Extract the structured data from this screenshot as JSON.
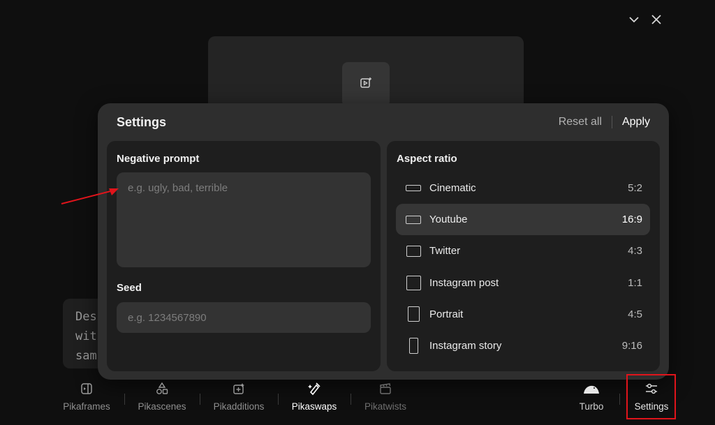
{
  "window": {
    "collapse_icon": "chevron-down-icon",
    "close_icon": "close-icon"
  },
  "background": {
    "prompt_preview_text": "Des\nwit\nsam"
  },
  "settings": {
    "title": "Settings",
    "reset_label": "Reset all",
    "apply_label": "Apply",
    "negative_prompt": {
      "label": "Negative prompt",
      "placeholder": "e.g. ugly, bad, terrible",
      "value": ""
    },
    "seed": {
      "label": "Seed",
      "placeholder": "e.g. 1234567890",
      "value": ""
    },
    "aspect_ratio": {
      "label": "Aspect ratio",
      "options": [
        {
          "name": "Cinematic",
          "ratio": "5:2",
          "selected": false
        },
        {
          "name": "Youtube",
          "ratio": "16:9",
          "selected": true
        },
        {
          "name": "Twitter",
          "ratio": "4:3",
          "selected": false
        },
        {
          "name": "Instagram post",
          "ratio": "1:1",
          "selected": false
        },
        {
          "name": "Portrait",
          "ratio": "4:5",
          "selected": false
        },
        {
          "name": "Instagram story",
          "ratio": "9:16",
          "selected": false
        }
      ]
    }
  },
  "toolbar": {
    "items": [
      {
        "label": "Pikaframes",
        "icon": "frames-icon"
      },
      {
        "label": "Pikascenes",
        "icon": "shapes-icon"
      },
      {
        "label": "Pikadditions",
        "icon": "add-media-icon"
      },
      {
        "label": "Pikaswaps",
        "icon": "brush-sparkle-icon"
      },
      {
        "label": "Pikatwists",
        "icon": "clapperboard-icon"
      },
      {
        "label": "Turbo",
        "icon": "turbo-icon"
      },
      {
        "label": "Settings",
        "icon": "sliders-icon"
      }
    ]
  },
  "colors": {
    "background": "#0f0f0f",
    "panel": "#2e2e2e",
    "card": "#1e1e1e",
    "input": "#333333",
    "highlight": "#e0141b"
  }
}
